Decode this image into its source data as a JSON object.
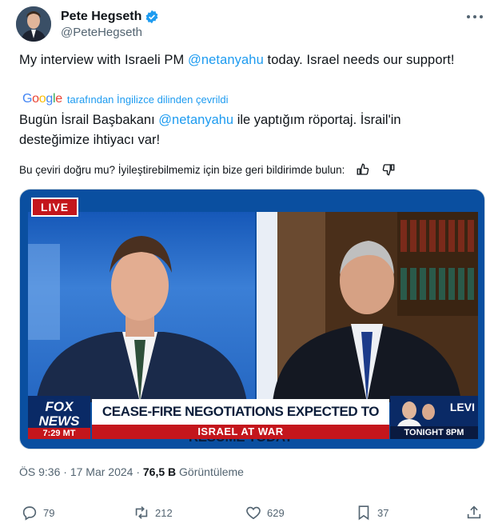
{
  "author": {
    "name": "Pete Hegseth",
    "handle": "@PeteHegseth",
    "verified_icon": "verified-badge-icon"
  },
  "tweet": {
    "text_before": "My interview with Israeli PM ",
    "mention": "@netanyahu",
    "text_after": " today. Israel needs our support!"
  },
  "translation": {
    "google": "Google",
    "source_note": "tarafından İngilizce dilinden çevrildi",
    "text_before": "Bugün İsrail Başbakanı ",
    "mention": "@netanyahu",
    "text_after": " ile yaptığım röportaj. İsrail'in desteğimize ihtiyacı var!",
    "feedback_question": "Bu çeviri doğru mu? İyileştirebilmemiz için bize geri bildirimde bulun:"
  },
  "media": {
    "live": "LIVE",
    "network": "FOX NEWS",
    "time": "7:29 MT",
    "headline": "CEASE-FIRE NEGOTIATIONS EXPECTED TO RESUME TODAY",
    "subhead": "ISRAEL AT WAR",
    "promo_name": "LEVI",
    "promo_bar": "TONIGHT 8PM",
    "colors": {
      "fox_red": "#c4161c",
      "fox_navy": "#0a2a66"
    }
  },
  "meta": {
    "time": "ÖS 9:36",
    "separator": "·",
    "date": "17 Mar 2024",
    "views": "76,5 B",
    "views_label": "Görüntüleme"
  },
  "actions": {
    "replies": "79",
    "reposts": "212",
    "likes": "629",
    "bookmarks": "37"
  },
  "accent": "#1d9bf0"
}
